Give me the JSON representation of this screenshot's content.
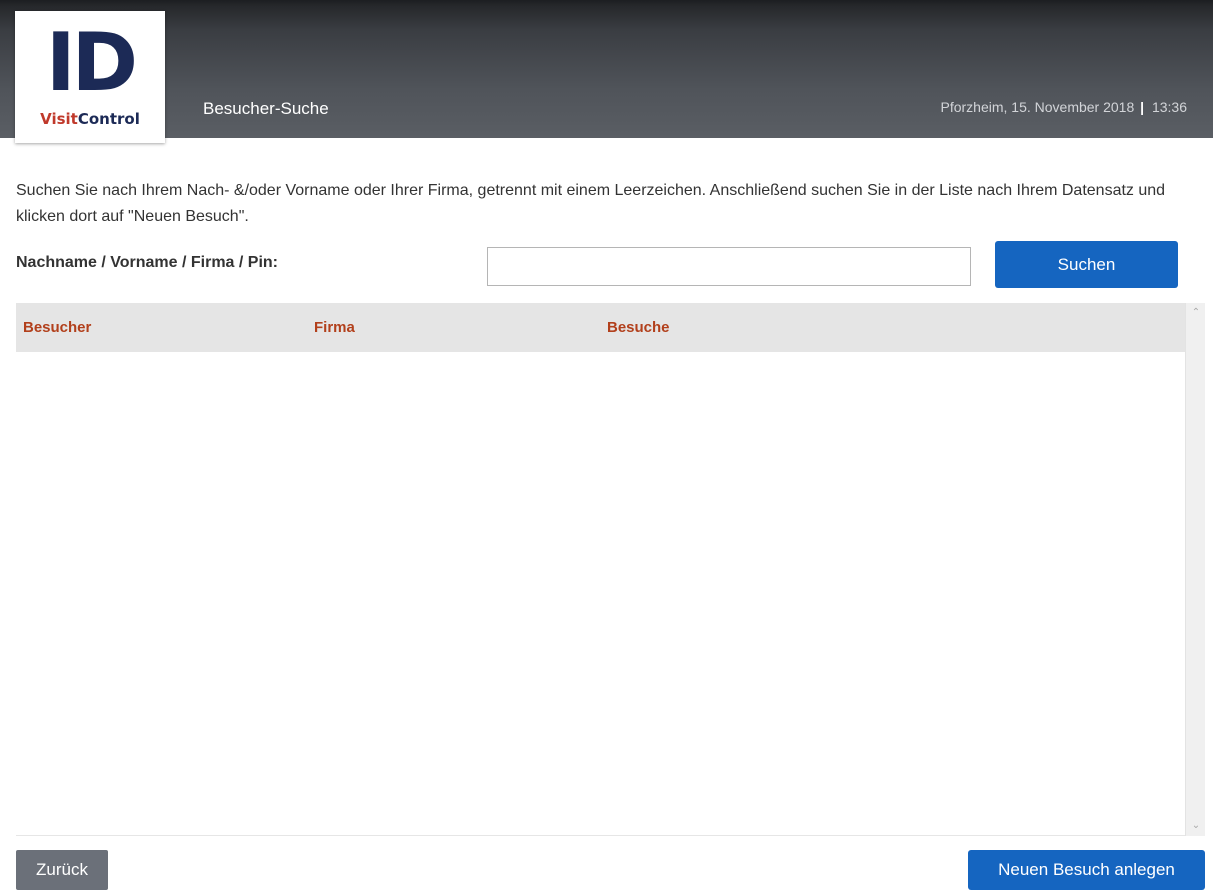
{
  "logo": {
    "main": "ID",
    "sub_part1": "Visit",
    "sub_part2": "Control"
  },
  "header": {
    "title": "Besucher-Suche",
    "location_date": "Pforzheim, 15. November 2018",
    "separator": "|",
    "time": "13:36"
  },
  "intro_text": "Suchen Sie nach Ihrem Nach- &/oder Vorname oder Ihrer Firma, getrennt mit einem Leerzeichen. Anschließend suchen Sie in der Liste nach Ihrem Datensatz und klicken dort auf \"Neuen Besuch\".",
  "search": {
    "label": "Nachname / Vorname / Firma / Pin:",
    "value": "",
    "button_label": "Suchen"
  },
  "table": {
    "columns": [
      "Besucher",
      "Firma",
      "Besuche"
    ],
    "rows": []
  },
  "scrollbar": {
    "up_icon": "chevron-up-icon",
    "down_icon": "chevron-down-icon"
  },
  "footer": {
    "back_label": "Zurück",
    "new_visit_label": "Neuen Besuch anlegen"
  },
  "colors": {
    "primary_button": "#1565c0",
    "secondary_button": "#6b7079",
    "table_header_text": "#b2401c",
    "logo_navy": "#1c2a56",
    "logo_red": "#c0392b"
  }
}
